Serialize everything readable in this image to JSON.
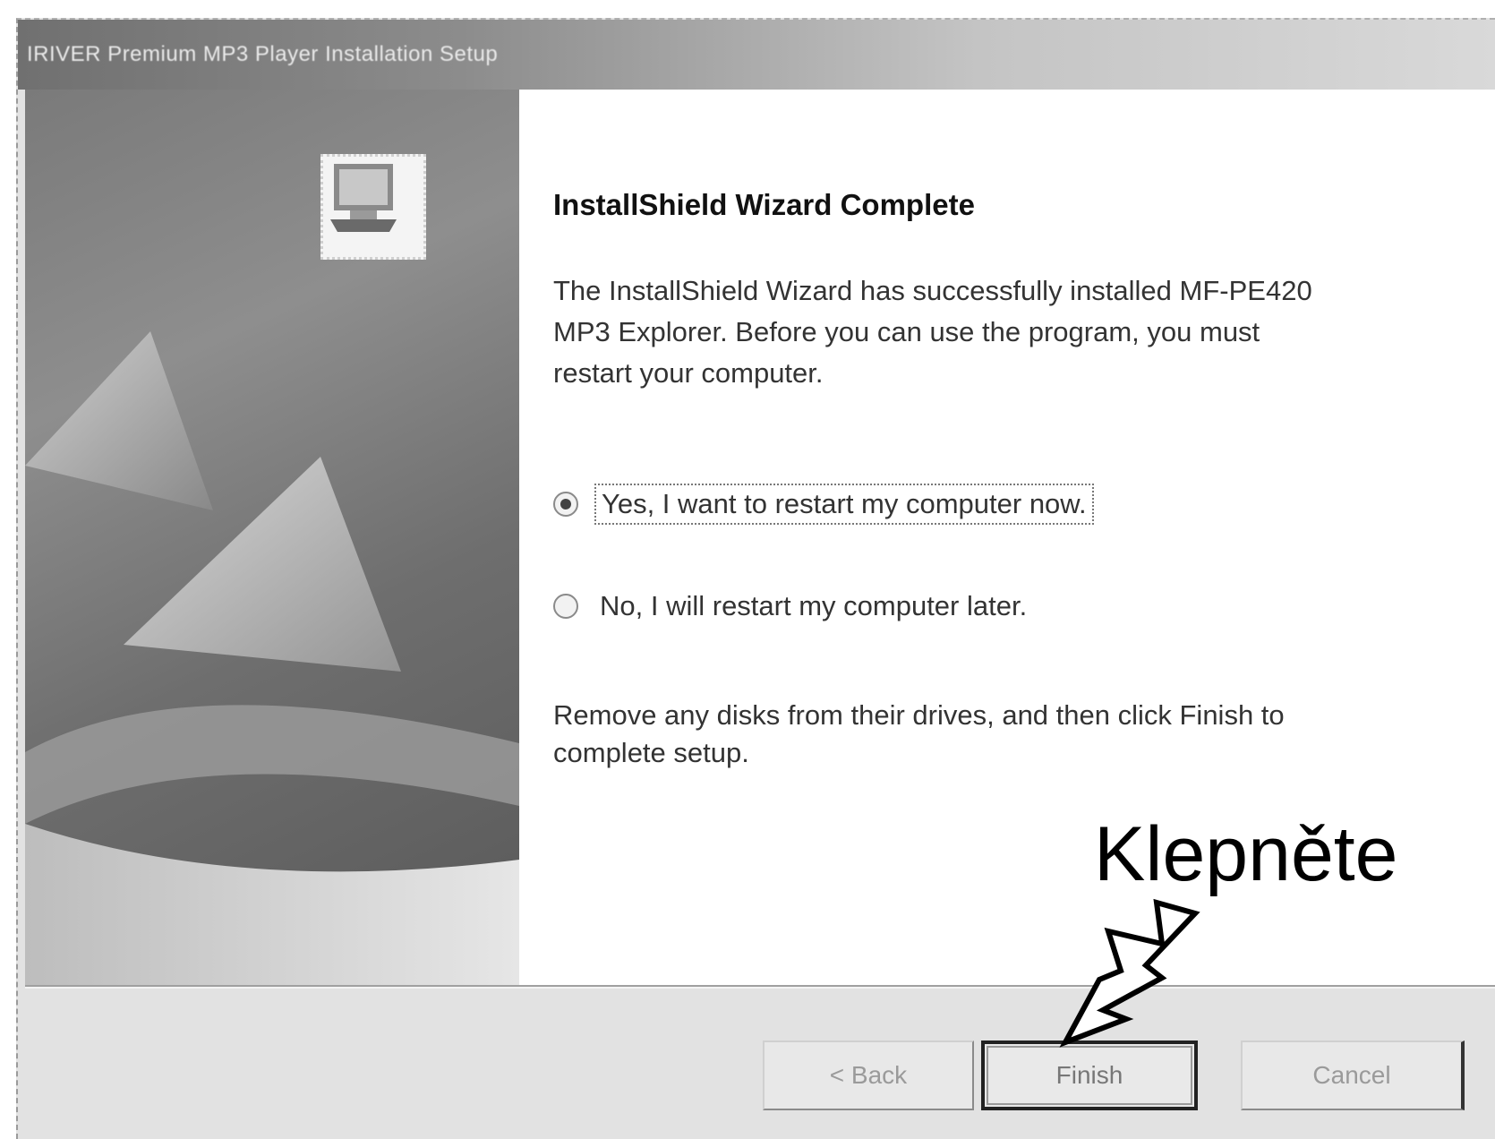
{
  "window": {
    "title": "IRIVER Premium MP3 Player Installation Setup"
  },
  "content": {
    "heading": "InstallShield Wizard Complete",
    "description_lines": [
      "The InstallShield Wizard has successfully installed MF-PE420",
      "MP3 Explorer. Before you can use the program, you must",
      "restart your computer."
    ],
    "options": [
      {
        "label": "Yes, I want to restart my computer now.",
        "selected": true
      },
      {
        "label": "No, I will restart my computer later.",
        "selected": false
      }
    ],
    "note_lines": [
      "Remove any disks from their drives, and then click Finish to",
      "complete setup."
    ]
  },
  "buttons": {
    "back": "< Back",
    "finish": "Finish",
    "cancel": "Cancel"
  },
  "annotation": {
    "label": "Klepněte"
  },
  "icons": {
    "wizard": "setup-computer-icon",
    "arrow": "pointer-arrow-icon"
  }
}
